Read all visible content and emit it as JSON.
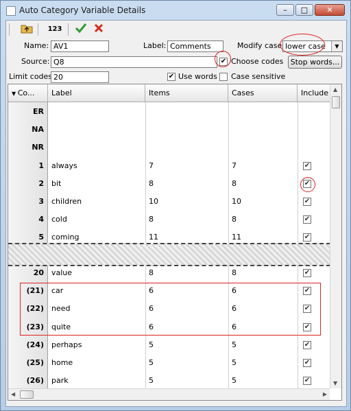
{
  "window": {
    "title": "Auto Category Variable Details",
    "min_label": "–",
    "max_label": "□",
    "close_label": "✕"
  },
  "toolbar": {
    "numbering_label": "123"
  },
  "form": {
    "name_label": "Name:",
    "name_value": "AV1",
    "label_label": "Label:",
    "label_value": "Comments",
    "modify_case_label": "Modify case:",
    "modify_case_value": "lower case",
    "source_label": "Source:",
    "source_value": "Q8",
    "choose_codes_label": "Choose codes",
    "choose_codes_checked": true,
    "stop_words_button": "Stop words...",
    "limit_codes_label": "Limit codes:",
    "limit_codes_value": "20",
    "use_words_label": "Use words",
    "use_words_checked": true,
    "case_sensitive_label": "Case sensitive",
    "case_sensitive_checked": false
  },
  "grid": {
    "columns": [
      "Co...",
      "Label",
      "Items",
      "Cases",
      "Include"
    ],
    "rows_top": [
      {
        "code": "ER",
        "label": "",
        "items": "",
        "cases": "",
        "include": null
      },
      {
        "code": "NA",
        "label": "",
        "items": "",
        "cases": "",
        "include": null
      },
      {
        "code": "NR",
        "label": "",
        "items": "",
        "cases": "",
        "include": null
      },
      {
        "code": "1",
        "label": "always",
        "items": "7",
        "cases": "7",
        "include": true
      },
      {
        "code": "2",
        "label": "bit",
        "items": "8",
        "cases": "8",
        "include": true
      },
      {
        "code": "3",
        "label": "children",
        "items": "10",
        "cases": "10",
        "include": true
      },
      {
        "code": "4",
        "label": "cold",
        "items": "8",
        "cases": "8",
        "include": true
      },
      {
        "code": "5",
        "label": "coming",
        "items": "11",
        "cases": "11",
        "include": true
      }
    ],
    "rows_bottom": [
      {
        "code": "20",
        "label": "value",
        "items": "8",
        "cases": "8",
        "include": true
      },
      {
        "code": "(21)",
        "label": "car",
        "items": "6",
        "cases": "6",
        "include": true
      },
      {
        "code": "(22)",
        "label": "need",
        "items": "6",
        "cases": "6",
        "include": true
      },
      {
        "code": "(23)",
        "label": "quite",
        "items": "6",
        "cases": "6",
        "include": true
      },
      {
        "code": "(24)",
        "label": "perhaps",
        "items": "5",
        "cases": "5",
        "include": true
      },
      {
        "code": "(25)",
        "label": "home",
        "items": "5",
        "cases": "5",
        "include": true
      },
      {
        "code": "(26)",
        "label": "park",
        "items": "5",
        "cases": "5",
        "include": true
      }
    ]
  },
  "colors": {
    "annotation": "#e02020",
    "check_green": "#2f9a2f",
    "cancel_red": "#d42a1c"
  }
}
